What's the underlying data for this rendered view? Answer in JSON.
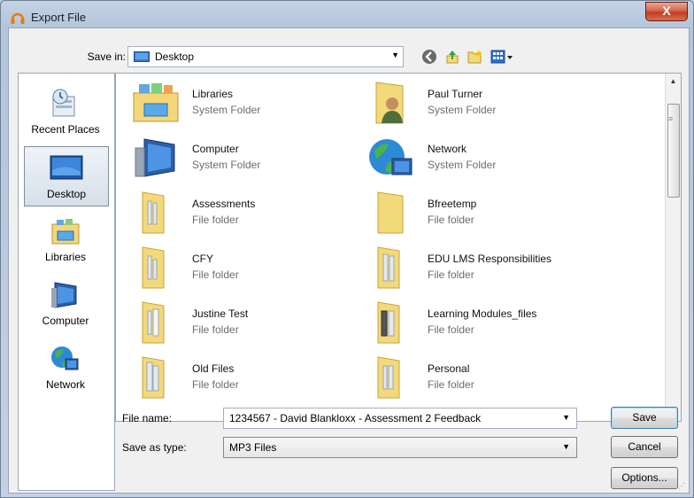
{
  "window": {
    "title": "Export File",
    "close_label": "X"
  },
  "save_in": {
    "label": "Save in:",
    "value": "Desktop",
    "icon": "desktop-icon"
  },
  "nav_icons": [
    "back-icon",
    "up-folder-icon",
    "new-folder-icon",
    "view-menu-icon"
  ],
  "places": [
    {
      "label": "Recent Places",
      "icon": "recent-places-icon",
      "selected": false
    },
    {
      "label": "Desktop",
      "icon": "desktop-icon",
      "selected": true
    },
    {
      "label": "Libraries",
      "icon": "libraries-icon",
      "selected": false
    },
    {
      "label": "Computer",
      "icon": "computer-icon",
      "selected": false
    },
    {
      "label": "Network",
      "icon": "network-icon",
      "selected": false
    }
  ],
  "files": [
    {
      "name": "Libraries",
      "type": "System Folder",
      "icon": "libraries-icon"
    },
    {
      "name": "Paul Turner",
      "type": "System Folder",
      "icon": "user-folder-icon"
    },
    {
      "name": "Computer",
      "type": "System Folder",
      "icon": "computer-icon"
    },
    {
      "name": "Network",
      "type": "System Folder",
      "icon": "network-icon"
    },
    {
      "name": "Assessments",
      "type": "File folder",
      "icon": "folder-icon"
    },
    {
      "name": "Bfreetemp",
      "type": "File folder",
      "icon": "folder-icon"
    },
    {
      "name": "CFY",
      "type": "File folder",
      "icon": "folder-icon"
    },
    {
      "name": "EDU LMS Responsibilities",
      "type": "File folder",
      "icon": "folder-icon"
    },
    {
      "name": "Justine Test",
      "type": "File folder",
      "icon": "folder-icon"
    },
    {
      "name": "Learning Modules_files",
      "type": "File folder",
      "icon": "folder-icon"
    },
    {
      "name": "Old Files",
      "type": "File folder",
      "icon": "folder-icon"
    },
    {
      "name": "Personal",
      "type": "File folder",
      "icon": "folder-icon"
    }
  ],
  "file_name": {
    "label": "File name:",
    "value": "1234567 - David Blankloxx - Assessment 2 Feedback"
  },
  "save_as_type": {
    "label": "Save as type:",
    "value": "MP3 Files"
  },
  "buttons": {
    "save": "Save",
    "cancel": "Cancel",
    "options": "Options..."
  },
  "colors": {
    "folder": "#f2d97a",
    "selection": "#d6e0ea",
    "title_bar": "#b3c5da"
  }
}
